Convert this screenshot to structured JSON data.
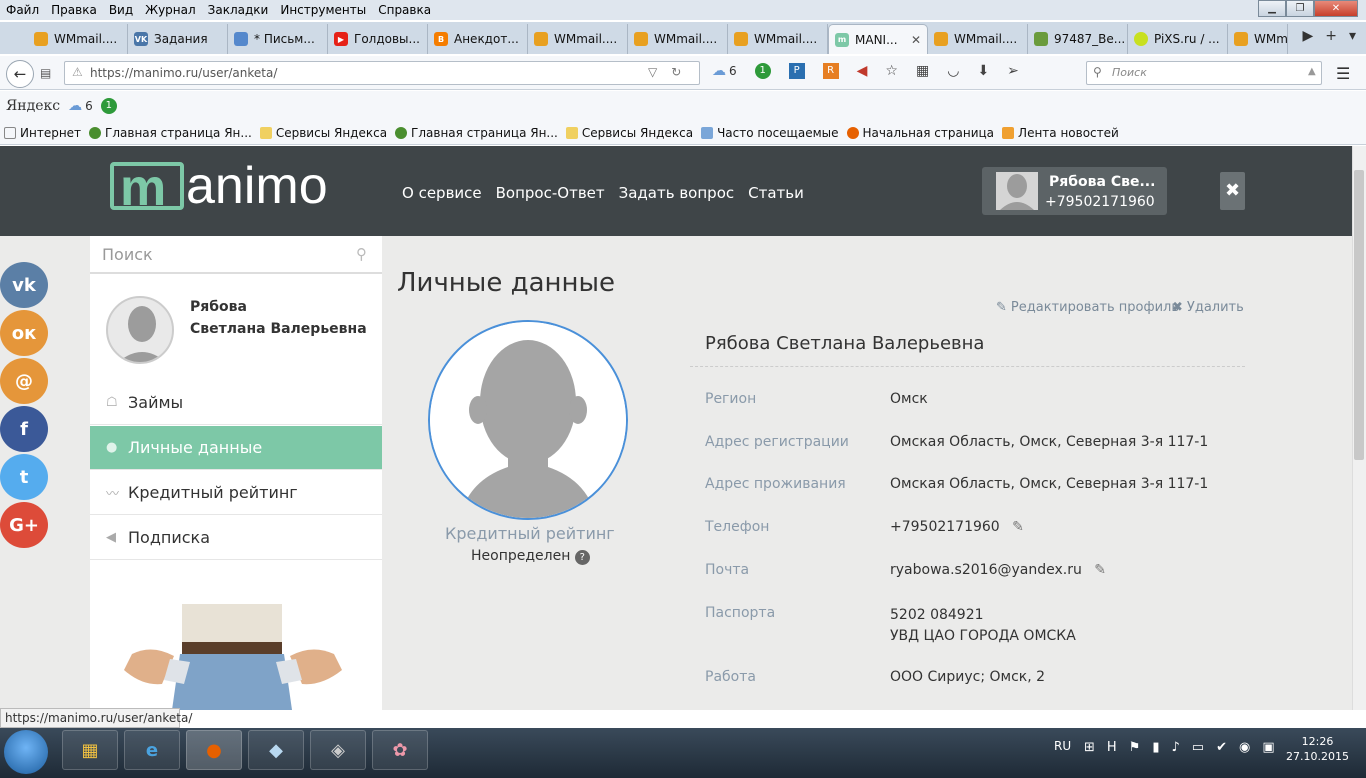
{
  "menubar": [
    "Файл",
    "Правка",
    "Вид",
    "Журнал",
    "Закладки",
    "Инструменты",
    "Справка"
  ],
  "tabs": [
    {
      "label": "WMmail....",
      "color": "#e8a020"
    },
    {
      "label": "Задания",
      "color": "#4a76a8",
      "icon_text": "VK"
    },
    {
      "label": "* Письм...",
      "color": "#5588cc"
    },
    {
      "label": "Голдовы...",
      "color": "#e62117"
    },
    {
      "label": "Анекдот...",
      "color": "#f57d00"
    },
    {
      "label": "WMmail....",
      "color": "#e8a020"
    },
    {
      "label": "WMmail....",
      "color": "#e8a020"
    },
    {
      "label": "WMmail....",
      "color": "#e8a020"
    },
    {
      "label": "MANI...",
      "color": "#7dc8a7",
      "active": true
    },
    {
      "label": "WMmail....",
      "color": "#e8a020"
    },
    {
      "label": "97487_Be...",
      "color": "#6a9b3c"
    },
    {
      "label": "PiXS.ru / ...",
      "color": "#c8e020"
    },
    {
      "label": "WMm",
      "color": "#e8a020"
    }
  ],
  "url": "https://manimo.ru/user/anketa/",
  "weather": "6",
  "notif_count": "1",
  "search_placeholder": "Поиск",
  "yandex": {
    "logo": "Яндекс",
    "weather": "6",
    "count": "1"
  },
  "bookmarks": [
    "Интернет",
    "Главная страница Ян...",
    "Сервисы Яндекса",
    "Главная страница Ян...",
    "Сервисы Яндекса",
    "Часто посещаемые",
    "Начальная страница",
    "Лента новостей"
  ],
  "site": {
    "logo_left": "m",
    "logo_right": "animo",
    "nav": [
      "О сервисе",
      "Вопрос-Ответ",
      "Задать вопрос",
      "Статьи"
    ],
    "user_name": "Рябова Све...",
    "user_phone": "+79502171960",
    "logout": "✖"
  },
  "social": [
    {
      "name": "vk",
      "symbol": "vk",
      "color": "#5b7fa6"
    },
    {
      "name": "ok",
      "symbol": "ок",
      "color": "#e5963a"
    },
    {
      "name": "mail",
      "symbol": "@",
      "color": "#e5963a"
    },
    {
      "name": "facebook",
      "symbol": "f",
      "color": "#3b5998"
    },
    {
      "name": "twitter",
      "symbol": "t",
      "color": "#55acee"
    },
    {
      "name": "gplus",
      "symbol": "G+",
      "color": "#dd4b39"
    }
  ],
  "sidebar": {
    "search_placeholder": "Поиск",
    "name_line1": "Рябова",
    "name_line2": "Светлана Валерьевна",
    "items": [
      {
        "label": "Займы",
        "icon": "☖"
      },
      {
        "label": "Личные данные",
        "icon": "●",
        "active": true
      },
      {
        "label": "Кредитный рейтинг",
        "icon": "〰"
      },
      {
        "label": "Подписка",
        "icon": "◀"
      }
    ]
  },
  "main": {
    "title": "Личные данные",
    "edit_profile": "Редактировать профиль",
    "delete": "Удалить",
    "rating_label": "Кредитный рейтинг",
    "rating_value": "Неопределен",
    "full_name": "Рябова Светлана Валерьевна",
    "fields": [
      {
        "label": "Регион",
        "value": "Омск"
      },
      {
        "label": "Адрес регистрации",
        "value": "Омская Область, Омск, Северная 3-я 117-1"
      },
      {
        "label": "Адрес проживания",
        "value": "Омская Область, Омск, Северная 3-я 117-1"
      },
      {
        "label": "Телефон",
        "value": "+79502171960",
        "editable": true
      },
      {
        "label": "Почта",
        "value": "ryabowa.s2016@yandex.ru",
        "editable": true
      },
      {
        "label": "Паспорта",
        "value": "5202 084921",
        "value2": "УВД ЦАО ГОРОДА ОМСКА"
      },
      {
        "label": "Работа",
        "value": "ООО Сириус; Омск, 2"
      }
    ]
  },
  "status_url": "https://manimo.ru/user/anketa/",
  "taskbar": {
    "lang": "RU",
    "time": "12:26",
    "date": "27.10.2015"
  },
  "colors": {
    "header": "#3f4548",
    "accent": "#7dc8a7",
    "avatar_border": "#4a90d9"
  }
}
